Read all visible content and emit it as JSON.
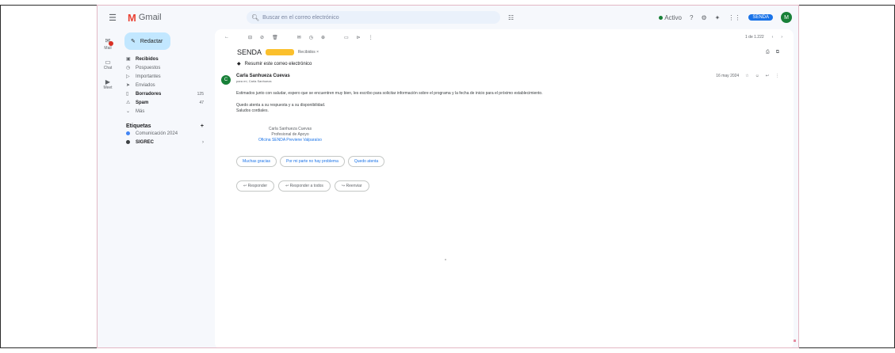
{
  "app": {
    "brand": "Gmail",
    "menu_icon": "menu-icon"
  },
  "search": {
    "placeholder": "Buscar en el correo electrónico",
    "filter_icon": "filter-icon"
  },
  "header": {
    "status_label": "Activo",
    "brand_label": "SENDA",
    "avatar_letter": "M"
  },
  "rail": {
    "items": [
      {
        "label": "Mail"
      },
      {
        "label": "Chat"
      },
      {
        "label": "Meet"
      }
    ]
  },
  "sidebar": {
    "compose_label": "Redactar",
    "items": [
      {
        "label": "Recibidos",
        "count": "",
        "bold": true
      },
      {
        "label": "Pospuestos",
        "count": ""
      },
      {
        "label": "Importantes",
        "count": ""
      },
      {
        "label": "Enviados",
        "count": ""
      },
      {
        "label": "Borradores",
        "count": "125",
        "bold": true
      },
      {
        "label": "Spam",
        "count": "47",
        "bold": true
      },
      {
        "label": "Más",
        "count": ""
      }
    ],
    "labels_title": "Etiquetas",
    "labels": [
      {
        "label": "Comunicación 2024",
        "color": "#4285f4"
      },
      {
        "label": "SIGREC",
        "color": "#3c4043"
      }
    ]
  },
  "toolbar": {
    "pagination": "1 de 1.222"
  },
  "email": {
    "subject": "SENDA",
    "chip_label": "Recibidos",
    "summary_label": "Resumir este correo electrónico",
    "sender_name": "Carla Sanhueza Cuevas",
    "sender_to": "para mí, Carla Sanhueza",
    "sender_date": "16 may 2024",
    "avatar_letter": "C",
    "body_lines": [
      "Estimados junto con saludar, espero que se encuentren muy bien, les escribo para solicitar información sobre el programa y la fecha de inicio para el próximo establecimiento.",
      "Quedo atenta a su respuesta y a su disponibilidad.",
      "Saludos cordiales."
    ],
    "signature": [
      "Carla Sanhueza Cuevas",
      "Profesional de Apoyo",
      "Oficina SENDA Previene Valparaíso"
    ],
    "smart_replies": [
      "Muchas gracias",
      "Por mi parte no hay problema",
      "Quedo atenta"
    ],
    "actions": [
      "Responder",
      "Responder a todos",
      "Reenviar"
    ]
  }
}
